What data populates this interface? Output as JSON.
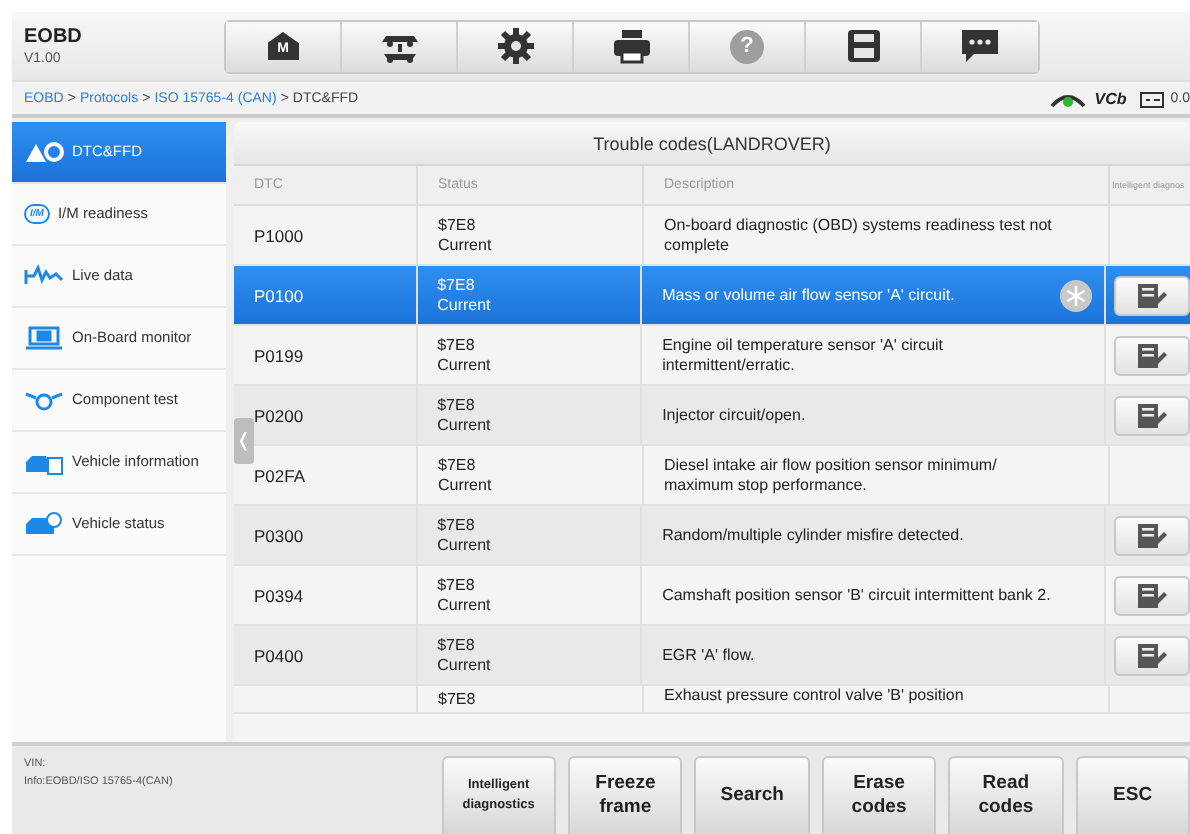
{
  "app": {
    "title": "EOBD",
    "version": "V1.00"
  },
  "toolbar": [
    {
      "kind": "home",
      "label": "M",
      "disabled": false
    },
    {
      "kind": "lift",
      "disabled": false
    },
    {
      "kind": "gear",
      "disabled": false
    },
    {
      "kind": "printer",
      "disabled": false
    },
    {
      "kind": "help",
      "label": "?",
      "disabled": true
    },
    {
      "kind": "save",
      "disabled": false
    },
    {
      "kind": "chat",
      "disabled": false
    }
  ],
  "breadcrumb": {
    "links": [
      "EOBD",
      "Protocols",
      "ISO 15765-4 (CAN)"
    ],
    "separator": ">",
    "current": "DTC&FFD"
  },
  "status": {
    "vci": "VCb",
    "battery": "0.0"
  },
  "sidebar": {
    "items": [
      {
        "kind": "dtc",
        "label": "DTC&FFD",
        "selected": true
      },
      {
        "kind": "im",
        "icon_text": "I/M",
        "label": "I/M readiness",
        "selected": false
      },
      {
        "kind": "live",
        "label": "Live data",
        "selected": false
      },
      {
        "kind": "monitor",
        "label": "On-Board monitor",
        "selected": false
      },
      {
        "kind": "component",
        "label": "Component test",
        "selected": false
      },
      {
        "kind": "info",
        "label": "Vehicle information",
        "selected": false
      },
      {
        "kind": "vstatus",
        "label": "Vehicle status",
        "selected": false
      }
    ],
    "collapse": "❬"
  },
  "table": {
    "title": "Trouble codes(LANDROVER)",
    "columns": [
      "DTC",
      "Status",
      "Description",
      "Intelligent diagnos"
    ],
    "rows": [
      {
        "dtc": "P1000",
        "status_id": "$7E8",
        "status": "Current",
        "description": "On-board diagnostic (OBD) systems readiness test not complete",
        "selected": false,
        "freeze_frame": false,
        "diagnose_button": false
      },
      {
        "dtc": "P0100",
        "status_id": "$7E8",
        "status": "Current",
        "description": "Mass or volume air flow sensor 'A' circuit.",
        "selected": true,
        "freeze_frame": true,
        "diagnose_button": true
      },
      {
        "dtc": "P0199",
        "status_id": "$7E8",
        "status": "Current",
        "description": "Engine oil temperature sensor 'A' circuit intermittent/erratic.",
        "selected": false,
        "freeze_frame": false,
        "diagnose_button": true
      },
      {
        "dtc": "P0200",
        "status_id": "$7E8",
        "status": "Current",
        "description": "Injector circuit/open.",
        "selected": false,
        "freeze_frame": false,
        "diagnose_button": true
      },
      {
        "dtc": "P02FA",
        "status_id": "$7E8",
        "status": "Current",
        "description": "Diesel intake air flow position sensor minimum/ maximum stop performance.",
        "selected": false,
        "freeze_frame": false,
        "diagnose_button": false
      },
      {
        "dtc": "P0300",
        "status_id": "$7E8",
        "status": "Current",
        "description": "Random/multiple cylinder misfire detected.",
        "selected": false,
        "freeze_frame": false,
        "diagnose_button": true
      },
      {
        "dtc": "P0394",
        "status_id": "$7E8",
        "status": "Current",
        "description": "Camshaft position sensor 'B' circuit intermittent bank 2.",
        "selected": false,
        "freeze_frame": false,
        "diagnose_button": true
      },
      {
        "dtc": "P0400",
        "status_id": "$7E8",
        "status": "Current",
        "description": "EGR 'A' flow.",
        "selected": false,
        "freeze_frame": false,
        "diagnose_button": true
      },
      {
        "status_id": "$7E8",
        "description": "Exhaust pressure control valve 'B' position",
        "selected": false,
        "freeze_frame": false,
        "diagnose_button": false
      }
    ]
  },
  "footer": {
    "vin": "VIN:",
    "info": "Info:EOBD/ISO 15765-4(CAN)",
    "buttons": [
      {
        "label": "Intelligent diagnostics",
        "small": true
      },
      {
        "label": "Freeze frame",
        "small": false
      },
      {
        "label": "Search",
        "small": false
      },
      {
        "label": "Erase codes",
        "small": false
      },
      {
        "label": "Read codes",
        "small": false
      },
      {
        "label": "ESC",
        "small": false
      }
    ]
  }
}
